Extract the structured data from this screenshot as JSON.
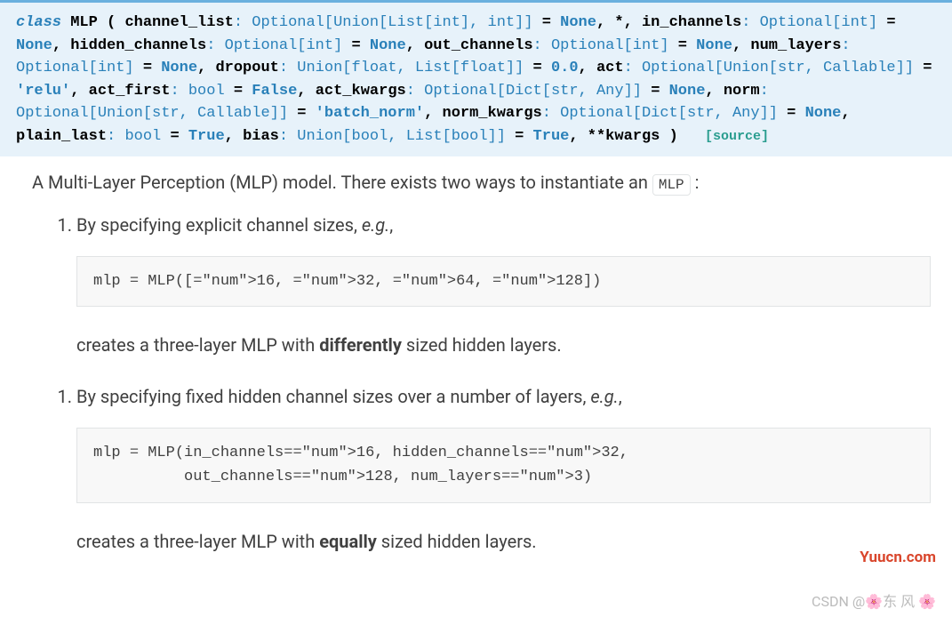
{
  "signature": {
    "keyword": "class",
    "classname": "MLP",
    "params": [
      {
        "name": "channel_list",
        "type": "Optional[Union[List[int], int]]",
        "default": "None"
      },
      {
        "name": "*",
        "type": "",
        "default": ""
      },
      {
        "name": "in_channels",
        "type": "Optional[int]",
        "default": "None"
      },
      {
        "name": "hidden_channels",
        "type": "Optional[int]",
        "default": "None"
      },
      {
        "name": "out_channels",
        "type": "Optional[int]",
        "default": "None"
      },
      {
        "name": "num_layers",
        "type": "Optional[int]",
        "default": "None"
      },
      {
        "name": "dropout",
        "type": "Union[float, List[float]]",
        "default": "0.0"
      },
      {
        "name": "act",
        "type": "Optional[Union[str, Callable]]",
        "default": "'relu'"
      },
      {
        "name": "act_first",
        "type": "bool",
        "default": "False"
      },
      {
        "name": "act_kwargs",
        "type": "Optional[Dict[str, Any]]",
        "default": "None"
      },
      {
        "name": "norm",
        "type": "Optional[Union[str, Callable]]",
        "default": "'batch_norm'"
      },
      {
        "name": "norm_kwargs",
        "type": "Optional[Dict[str, Any]]",
        "default": "None"
      },
      {
        "name": "plain_last",
        "type": "bool",
        "default": "True"
      },
      {
        "name": "bias",
        "type": "Union[bool, List[bool]]",
        "default": "True"
      },
      {
        "name": "**kwargs",
        "type": "",
        "default": ""
      }
    ],
    "source_label": "[source]"
  },
  "intro_text_prefix": "A Multi-Layer Perception (MLP) model. There exists two ways to instantiate an ",
  "intro_code": "MLP",
  "intro_suffix": " :",
  "item1": {
    "text_prefix": "By specifying explicit channel sizes, ",
    "text_em": "e.g.",
    "text_suffix": ",",
    "code_line": "mlp = MLP([16, 32, 64, 128])",
    "desc_prefix": "creates a three-layer MLP with ",
    "desc_strong": "differently",
    "desc_suffix": " sized hidden layers."
  },
  "item2": {
    "text_prefix": "By specifying fixed hidden channel sizes over a number of layers, ",
    "text_em": "e.g.",
    "text_suffix": ",",
    "code_line1": "mlp = MLP(in_channels=16, hidden_channels=32,",
    "code_line2": "          out_channels=128, num_layers=3)",
    "desc_prefix": "creates a three-layer MLP with ",
    "desc_strong": "equally",
    "desc_suffix": " sized hidden layers."
  },
  "watermark_red": "Yuucn.com",
  "watermark_gray": "CSDN @🌸东 风 🌸"
}
